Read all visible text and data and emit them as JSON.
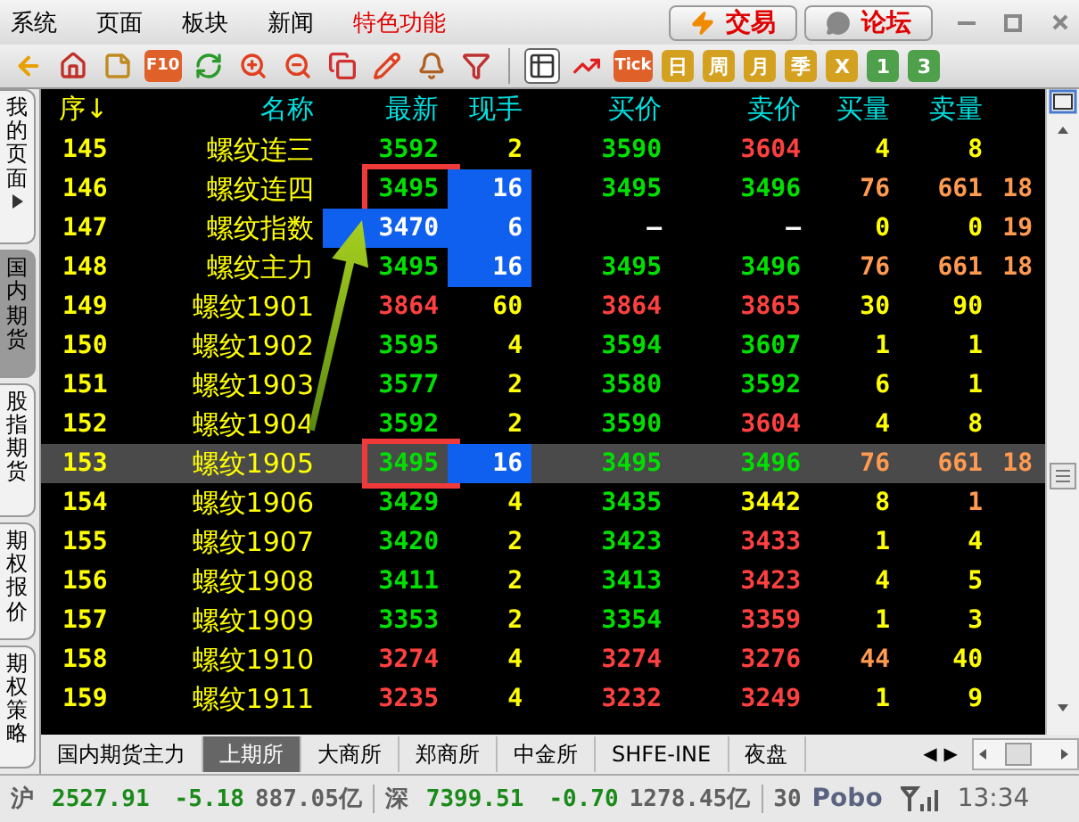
{
  "menu": [
    {
      "label": "系统",
      "highlighted": false
    },
    {
      "label": "页面",
      "highlighted": false
    },
    {
      "label": "板块",
      "highlighted": false
    },
    {
      "label": "新闻",
      "highlighted": false
    },
    {
      "label": "特色功能",
      "highlighted": true
    }
  ],
  "action_buttons": [
    {
      "kind": "trade",
      "label": "交易"
    },
    {
      "kind": "forum",
      "label": "论坛"
    }
  ],
  "toolbar": [
    {
      "kind": "icon",
      "selected": false
    },
    {
      "kind": "icon",
      "selected": false
    },
    {
      "kind": "icon",
      "selected": false
    },
    {
      "kind": "tile",
      "label": "F10",
      "color": "#e0602a",
      "selected": false
    },
    {
      "kind": "icon",
      "selected": false
    },
    {
      "kind": "icon",
      "selected": false
    },
    {
      "kind": "icon",
      "selected": false
    },
    {
      "kind": "icon",
      "selected": false
    },
    {
      "kind": "icon",
      "selected": false
    },
    {
      "kind": "icon",
      "selected": false
    },
    {
      "kind": "icon",
      "selected": false
    },
    {
      "kind": "divider"
    },
    {
      "kind": "icon",
      "selected": true
    },
    {
      "kind": "icon",
      "selected": false
    },
    {
      "kind": "tile",
      "label": "Tick",
      "color": "#e0602a",
      "selected": false
    },
    {
      "kind": "tile",
      "label": "日",
      "color": "#d4a020",
      "selected": false
    },
    {
      "kind": "tile",
      "label": "周",
      "color": "#d4a020",
      "selected": false
    },
    {
      "kind": "tile",
      "label": "月",
      "color": "#d4a020",
      "selected": false
    },
    {
      "kind": "tile",
      "label": "季",
      "color": "#d4a020",
      "selected": false
    },
    {
      "kind": "tile",
      "label": "X",
      "color": "#d4a020",
      "selected": false
    },
    {
      "kind": "tile",
      "label": "1",
      "color": "#4ea04a",
      "selected": false
    },
    {
      "kind": "tile",
      "label": "3",
      "color": "#4ea04a",
      "selected": false
    }
  ],
  "side_tabs": [
    {
      "label": "我的页面",
      "selected": false,
      "has_arrow": true
    },
    {
      "label": "国内期货",
      "selected": true,
      "has_arrow": false
    },
    {
      "label": "股指期货",
      "selected": false,
      "has_arrow": false
    },
    {
      "label": "期权报价",
      "selected": false,
      "has_arrow": false
    },
    {
      "label": "期权策略",
      "selected": false,
      "has_arrow": false
    }
  ],
  "table": {
    "columns": [
      "序↓",
      "名称",
      "最新",
      "现手",
      "买价",
      "卖价",
      "买量",
      "卖量"
    ],
    "rows": [
      {
        "selected": false,
        "last_flash": false,
        "vol_flash": false,
        "last_boxed": false,
        "cells": [
          {
            "text": "145"
          },
          {
            "text": "螺纹连三"
          },
          {
            "text": "3592",
            "color": "#00e000"
          },
          {
            "text": "2",
            "color": "#ffff00"
          },
          {
            "text": "3590",
            "color": "#00e000"
          },
          {
            "text": "3604",
            "color": "#ff4040"
          },
          {
            "text": "4",
            "color": "#ffff00"
          },
          {
            "text": "8",
            "color": "#ffff00"
          }
        ]
      },
      {
        "selected": false,
        "last_flash": false,
        "vol_flash": true,
        "last_boxed": true,
        "cells": [
          {
            "text": "146"
          },
          {
            "text": "螺纹连四"
          },
          {
            "text": "3495",
            "color": "#00e000"
          },
          {
            "text": "16",
            "color": "#ffffff"
          },
          {
            "text": "3495",
            "color": "#00e000"
          },
          {
            "text": "3496",
            "color": "#00e000"
          },
          {
            "text": "76",
            "color": "#ff9a50"
          },
          {
            "text": "661",
            "color": "#ff9a50"
          },
          {
            "text": "18",
            "color": "#ff9a50"
          }
        ]
      },
      {
        "selected": false,
        "last_flash": true,
        "vol_flash": true,
        "last_boxed": false,
        "cells": [
          {
            "text": "147"
          },
          {
            "text": "螺纹指数"
          },
          {
            "text": "3470",
            "color": "#ffffff"
          },
          {
            "text": "6",
            "color": "#ffffff"
          },
          {
            "text": "—",
            "color": "#ffffff"
          },
          {
            "text": "—",
            "color": "#ffffff"
          },
          {
            "text": "0",
            "color": "#ffff00"
          },
          {
            "text": "0",
            "color": "#ffff00"
          },
          {
            "text": "19",
            "color": "#ff9a50"
          }
        ]
      },
      {
        "selected": false,
        "last_flash": false,
        "vol_flash": true,
        "last_boxed": false,
        "cells": [
          {
            "text": "148"
          },
          {
            "text": "螺纹主力"
          },
          {
            "text": "3495",
            "color": "#00e000"
          },
          {
            "text": "16",
            "color": "#ffffff"
          },
          {
            "text": "3495",
            "color": "#00e000"
          },
          {
            "text": "3496",
            "color": "#00e000"
          },
          {
            "text": "76",
            "color": "#ff9a50"
          },
          {
            "text": "661",
            "color": "#ff9a50"
          },
          {
            "text": "18",
            "color": "#ff9a50"
          }
        ]
      },
      {
        "selected": false,
        "last_flash": false,
        "vol_flash": false,
        "last_boxed": false,
        "cells": [
          {
            "text": "149"
          },
          {
            "text": "螺纹1901"
          },
          {
            "text": "3864",
            "color": "#ff4040"
          },
          {
            "text": "60",
            "color": "#ffff00"
          },
          {
            "text": "3864",
            "color": "#ff4040"
          },
          {
            "text": "3865",
            "color": "#ff4040"
          },
          {
            "text": "30",
            "color": "#ffff00"
          },
          {
            "text": "90",
            "color": "#ffff00"
          }
        ]
      },
      {
        "selected": false,
        "last_flash": false,
        "vol_flash": false,
        "last_boxed": false,
        "cells": [
          {
            "text": "150"
          },
          {
            "text": "螺纹1902"
          },
          {
            "text": "3595",
            "color": "#00e000"
          },
          {
            "text": "4",
            "color": "#ffff00"
          },
          {
            "text": "3594",
            "color": "#00e000"
          },
          {
            "text": "3607",
            "color": "#00e000"
          },
          {
            "text": "1",
            "color": "#ffff00"
          },
          {
            "text": "1",
            "color": "#ffff00"
          }
        ]
      },
      {
        "selected": false,
        "last_flash": false,
        "vol_flash": false,
        "last_boxed": false,
        "cells": [
          {
            "text": "151"
          },
          {
            "text": "螺纹1903"
          },
          {
            "text": "3577",
            "color": "#00e000"
          },
          {
            "text": "2",
            "color": "#ffff00"
          },
          {
            "text": "3580",
            "color": "#00e000"
          },
          {
            "text": "3592",
            "color": "#00e000"
          },
          {
            "text": "6",
            "color": "#ffff00"
          },
          {
            "text": "1",
            "color": "#ffff00"
          }
        ]
      },
      {
        "selected": false,
        "last_flash": false,
        "vol_flash": false,
        "last_boxed": false,
        "cells": [
          {
            "text": "152"
          },
          {
            "text": "螺纹1904"
          },
          {
            "text": "3592",
            "color": "#00e000"
          },
          {
            "text": "2",
            "color": "#ffff00"
          },
          {
            "text": "3590",
            "color": "#00e000"
          },
          {
            "text": "3604",
            "color": "#ff4040"
          },
          {
            "text": "4",
            "color": "#ffff00"
          },
          {
            "text": "8",
            "color": "#ffff00"
          }
        ]
      },
      {
        "selected": true,
        "last_flash": false,
        "vol_flash": true,
        "last_boxed": true,
        "cells": [
          {
            "text": "153"
          },
          {
            "text": "螺纹1905"
          },
          {
            "text": "3495",
            "color": "#00e000"
          },
          {
            "text": "16",
            "color": "#ffffff"
          },
          {
            "text": "3495",
            "color": "#00e000"
          },
          {
            "text": "3496",
            "color": "#00e000"
          },
          {
            "text": "76",
            "color": "#ff9a50"
          },
          {
            "text": "661",
            "color": "#ff9a50"
          },
          {
            "text": "18",
            "color": "#ff9a50"
          }
        ]
      },
      {
        "selected": false,
        "last_flash": false,
        "vol_flash": false,
        "last_boxed": false,
        "cells": [
          {
            "text": "154"
          },
          {
            "text": "螺纹1906"
          },
          {
            "text": "3429",
            "color": "#00e000"
          },
          {
            "text": "4",
            "color": "#ffff00"
          },
          {
            "text": "3435",
            "color": "#00e000"
          },
          {
            "text": "3442",
            "color": "#ffff00"
          },
          {
            "text": "8",
            "color": "#ffff00"
          },
          {
            "text": "1",
            "color": "#ff9a50"
          }
        ]
      },
      {
        "selected": false,
        "last_flash": false,
        "vol_flash": false,
        "last_boxed": false,
        "cells": [
          {
            "text": "155"
          },
          {
            "text": "螺纹1907"
          },
          {
            "text": "3420",
            "color": "#00e000"
          },
          {
            "text": "2",
            "color": "#ffff00"
          },
          {
            "text": "3423",
            "color": "#00e000"
          },
          {
            "text": "3433",
            "color": "#ff4040"
          },
          {
            "text": "1",
            "color": "#ffff00"
          },
          {
            "text": "4",
            "color": "#ffff00"
          }
        ]
      },
      {
        "selected": false,
        "last_flash": false,
        "vol_flash": false,
        "last_boxed": false,
        "cells": [
          {
            "text": "156"
          },
          {
            "text": "螺纹1908"
          },
          {
            "text": "3411",
            "color": "#00e000"
          },
          {
            "text": "2",
            "color": "#ffff00"
          },
          {
            "text": "3413",
            "color": "#00e000"
          },
          {
            "text": "3423",
            "color": "#ff4040"
          },
          {
            "text": "4",
            "color": "#ffff00"
          },
          {
            "text": "5",
            "color": "#ffff00"
          }
        ]
      },
      {
        "selected": false,
        "last_flash": false,
        "vol_flash": false,
        "last_boxed": false,
        "cells": [
          {
            "text": "157"
          },
          {
            "text": "螺纹1909"
          },
          {
            "text": "3353",
            "color": "#00e000"
          },
          {
            "text": "2",
            "color": "#ffff00"
          },
          {
            "text": "3354",
            "color": "#00e000"
          },
          {
            "text": "3359",
            "color": "#ff4040"
          },
          {
            "text": "1",
            "color": "#ffff00"
          },
          {
            "text": "3",
            "color": "#ffff00"
          }
        ]
      },
      {
        "selected": false,
        "last_flash": false,
        "vol_flash": false,
        "last_boxed": false,
        "cells": [
          {
            "text": "158"
          },
          {
            "text": "螺纹1910"
          },
          {
            "text": "3274",
            "color": "#ff4040"
          },
          {
            "text": "4",
            "color": "#ffff00"
          },
          {
            "text": "3274",
            "color": "#ff4040"
          },
          {
            "text": "3276",
            "color": "#ff4040"
          },
          {
            "text": "44",
            "color": "#ff9a50"
          },
          {
            "text": "40",
            "color": "#ffff00"
          }
        ]
      },
      {
        "selected": false,
        "last_flash": false,
        "vol_flash": false,
        "last_boxed": false,
        "cells": [
          {
            "text": "159"
          },
          {
            "text": "螺纹1911"
          },
          {
            "text": "3235",
            "color": "#ff4040"
          },
          {
            "text": "4",
            "color": "#ffff00"
          },
          {
            "text": "3232",
            "color": "#ff4040"
          },
          {
            "text": "3249",
            "color": "#ff4040"
          },
          {
            "text": "1",
            "color": "#ffff00"
          },
          {
            "text": "9",
            "color": "#ffff00"
          }
        ]
      }
    ]
  },
  "exchange_tabs": [
    {
      "label": "国内期货主力",
      "selected": false
    },
    {
      "label": "上期所",
      "selected": true
    },
    {
      "label": "大商所",
      "selected": false
    },
    {
      "label": "郑商所",
      "selected": false
    },
    {
      "label": "中金所",
      "selected": false
    },
    {
      "label": "SHFE-INE",
      "selected": false
    },
    {
      "label": "夜盘",
      "selected": false
    }
  ],
  "tab_arrows": [
    "◀",
    "▶"
  ],
  "status_bar": [
    {
      "kind": "label",
      "text": "沪",
      "color": "#606060"
    },
    {
      "kind": "value",
      "text": "2527.91",
      "color": "#1a8a1a"
    },
    {
      "kind": "value",
      "text": "-5.18",
      "color": "#1a8a1a"
    },
    {
      "kind": "value",
      "text": "887.05亿",
      "color": "#606060"
    },
    {
      "kind": "divider"
    },
    {
      "kind": "label",
      "text": "深",
      "color": "#606060"
    },
    {
      "kind": "value",
      "text": "7399.51",
      "color": "#1a8a1a"
    },
    {
      "kind": "value",
      "text": "-0.70",
      "color": "#1a8a1a"
    },
    {
      "kind": "value",
      "text": "1278.45亿",
      "color": "#606060"
    },
    {
      "kind": "divider"
    },
    {
      "kind": "value",
      "text": "30",
      "color": "#606060"
    },
    {
      "kind": "logo",
      "text": "Pobo",
      "color": "#5a6480"
    },
    {
      "kind": "signal"
    },
    {
      "kind": "clock",
      "text": "13:34",
      "color": "#606060"
    }
  ]
}
